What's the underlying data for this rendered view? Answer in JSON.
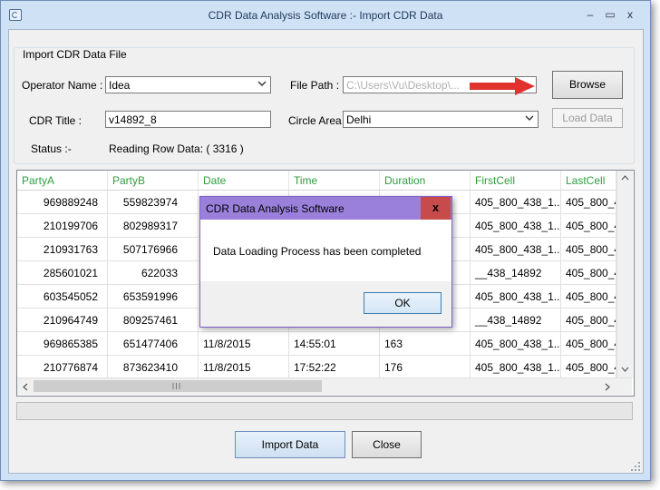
{
  "window": {
    "title": "CDR Data Analysis Software :- Import CDR Data"
  },
  "group": {
    "title": "Import CDR Data File"
  },
  "form": {
    "operator_label": "Operator Name :",
    "operator_value": "Idea",
    "filepath_label": "File Path :",
    "filepath_value": "C:\\Users\\Vu\\Desktop\\...",
    "browse_label": "Browse",
    "cdr_title_label": "CDR Title :",
    "cdr_title_value": "v14892_8",
    "circle_label": "Circle Area :",
    "circle_value": "Delhi",
    "load_label": "Load Data",
    "status_label": "Status :-",
    "status_value": "Reading Row Data: ( 3316 )"
  },
  "table": {
    "columns": [
      "PartyA",
      "PartyB",
      "Date",
      "Time",
      "Duration",
      "FirstCell",
      "LastCell"
    ],
    "rows": [
      [
        "969889248",
        "559823974",
        "",
        "",
        "",
        "405_800_438_1...",
        "405_800_4"
      ],
      [
        "210199706",
        "802989317",
        "",
        "",
        "",
        "405_800_438_1...",
        "405_800_4"
      ],
      [
        "210931763",
        "507176966",
        "",
        "",
        "",
        "405_800_438_1...",
        "405_800_4"
      ],
      [
        "285601021",
        "622033",
        "",
        "",
        "",
        "__438_14892",
        "405_800_4"
      ],
      [
        "603545052",
        "653591996",
        "",
        "",
        "",
        "405_800_438_1...",
        "405_800_4"
      ],
      [
        "210964749",
        "809257461",
        "",
        "",
        "",
        "__438_14892",
        "405_800_4"
      ],
      [
        "969865385",
        "651477406",
        "11/8/2015",
        "14:55:01",
        "163",
        "405_800_438_1...",
        "405_800_4"
      ],
      [
        "210776874",
        "873623410",
        "11/8/2015",
        "17:52:22",
        "176",
        "405_800_438_1...",
        "405_800_4"
      ]
    ]
  },
  "bottom": {
    "import_label": "Import Data",
    "close_label": "Close"
  },
  "dialog": {
    "title": "CDR Data Analysis Software",
    "message": "Data Loading Process has been completed",
    "ok_label": "OK",
    "close_glyph": "x"
  },
  "icons": {
    "window_minimize": "‒",
    "window_maximize": "▭",
    "window_close": "x",
    "combo": "chevron-down-icon"
  }
}
